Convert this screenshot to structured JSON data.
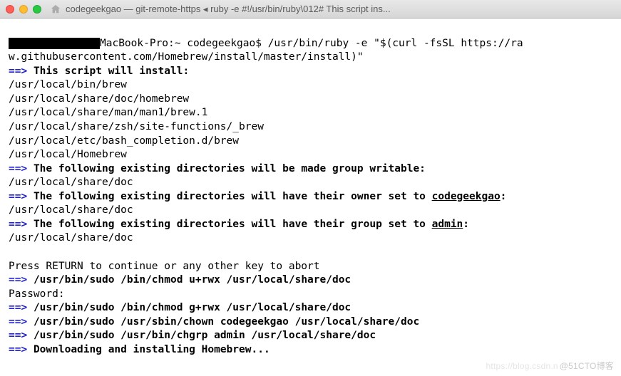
{
  "window": {
    "title": "codegeekgao — git-remote-https ◂ ruby -e #!/usr/bin/ruby\\012# This script ins..."
  },
  "prompt": {
    "host": "MacBook-Pro:~ codegeekgao$ ",
    "cmd1": "/usr/bin/ruby -e \"$(curl -fsSL https://ra",
    "cmd2": "w.githubusercontent.com/Homebrew/install/master/install)\""
  },
  "arrow": "==>",
  "sec1_title": "This script will install:",
  "install_paths": [
    "/usr/local/bin/brew",
    "/usr/local/share/doc/homebrew",
    "/usr/local/share/man/man1/brew.1",
    "/usr/local/share/zsh/site-functions/_brew",
    "/usr/local/etc/bash_completion.d/brew",
    "/usr/local/Homebrew"
  ],
  "sec2_title": "The following existing directories will be made group writable:",
  "sec2_path": "/usr/local/share/doc",
  "sec3_title_a": "The following existing directories will have their owner set to ",
  "sec3_user": "codegeekgao",
  "sec3_title_b": ":",
  "sec3_path": "/usr/local/share/doc",
  "sec4_title_a": "The following existing directories will have their group set to ",
  "sec4_group": "admin",
  "sec4_title_b": ":",
  "sec4_path": "/usr/local/share/doc",
  "press_return": "Press RETURN to continue or any other key to abort",
  "sudo1": "/usr/bin/sudo /bin/chmod u+rwx /usr/local/share/doc",
  "password_label": "Password:",
  "sudo2": "/usr/bin/sudo /bin/chmod g+rwx /usr/local/share/doc",
  "sudo3": "/usr/bin/sudo /usr/sbin/chown codegeekgao /usr/local/share/doc",
  "sudo4": "/usr/bin/sudo /usr/bin/chgrp admin /usr/local/share/doc",
  "downloading": "Downloading and installing Homebrew...",
  "watermark": {
    "left": "https://blog.csdn.n",
    "right": "@51CTO博客"
  }
}
